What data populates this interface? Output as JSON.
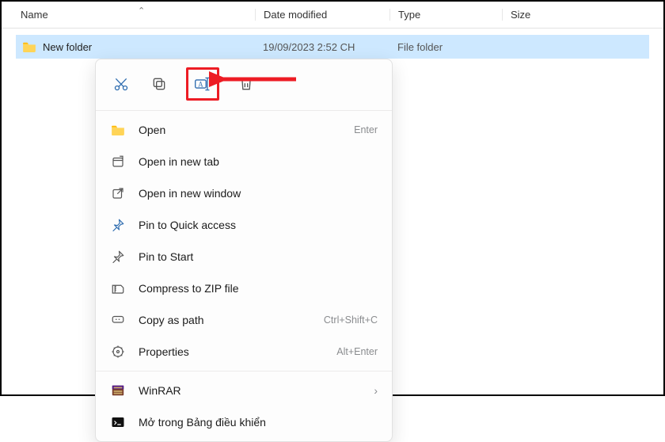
{
  "columns": {
    "name": "Name",
    "date": "Date modified",
    "type": "Type",
    "size": "Size"
  },
  "row": {
    "name": "New folder",
    "date": "19/09/2023 2:52 CH",
    "type": "File folder"
  },
  "toolbar": {
    "cut": "cut",
    "copy": "copy",
    "rename": "rename",
    "delete": "delete"
  },
  "menu": {
    "open": {
      "label": "Open",
      "accel": "Enter"
    },
    "open_tab": {
      "label": "Open in new tab",
      "accel": ""
    },
    "open_window": {
      "label": "Open in new window",
      "accel": ""
    },
    "pin_quick": {
      "label": "Pin to Quick access",
      "accel": ""
    },
    "pin_start": {
      "label": "Pin to Start",
      "accel": ""
    },
    "compress": {
      "label": "Compress to ZIP file",
      "accel": ""
    },
    "copy_path": {
      "label": "Copy as path",
      "accel": "Ctrl+Shift+C"
    },
    "properties": {
      "label": "Properties",
      "accel": "Alt+Enter"
    },
    "winrar": {
      "label": "WinRAR",
      "accel": ""
    },
    "control_panel": {
      "label": "Mở trong Bảng điều khiển",
      "accel": ""
    }
  },
  "annotation": {
    "highlight_color": "#ed1c24",
    "arrow_color": "#ed1c24"
  }
}
